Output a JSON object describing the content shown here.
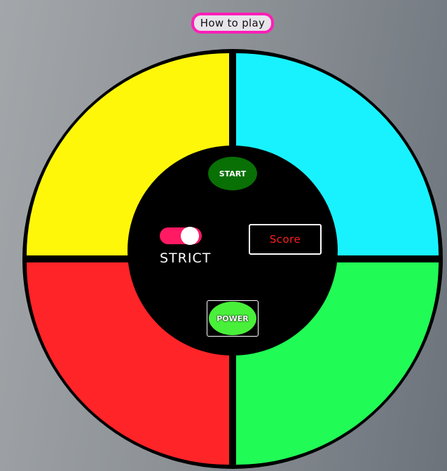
{
  "header": {
    "how_to_play_label": "How to play"
  },
  "board": {
    "colors": {
      "yellow": "#fff70a",
      "cyan": "#18f2ff",
      "red": "#ff2428",
      "green": "#21fb55"
    },
    "start_label": "START",
    "start_color": "#087005",
    "score_label": "Score",
    "score_color": "#ff1e1e",
    "strict_label": "STRICT",
    "strict_toggle_on": true,
    "toggle_color": "#ff1a63",
    "power_label": "POWER",
    "power_color": "#48f03a"
  }
}
